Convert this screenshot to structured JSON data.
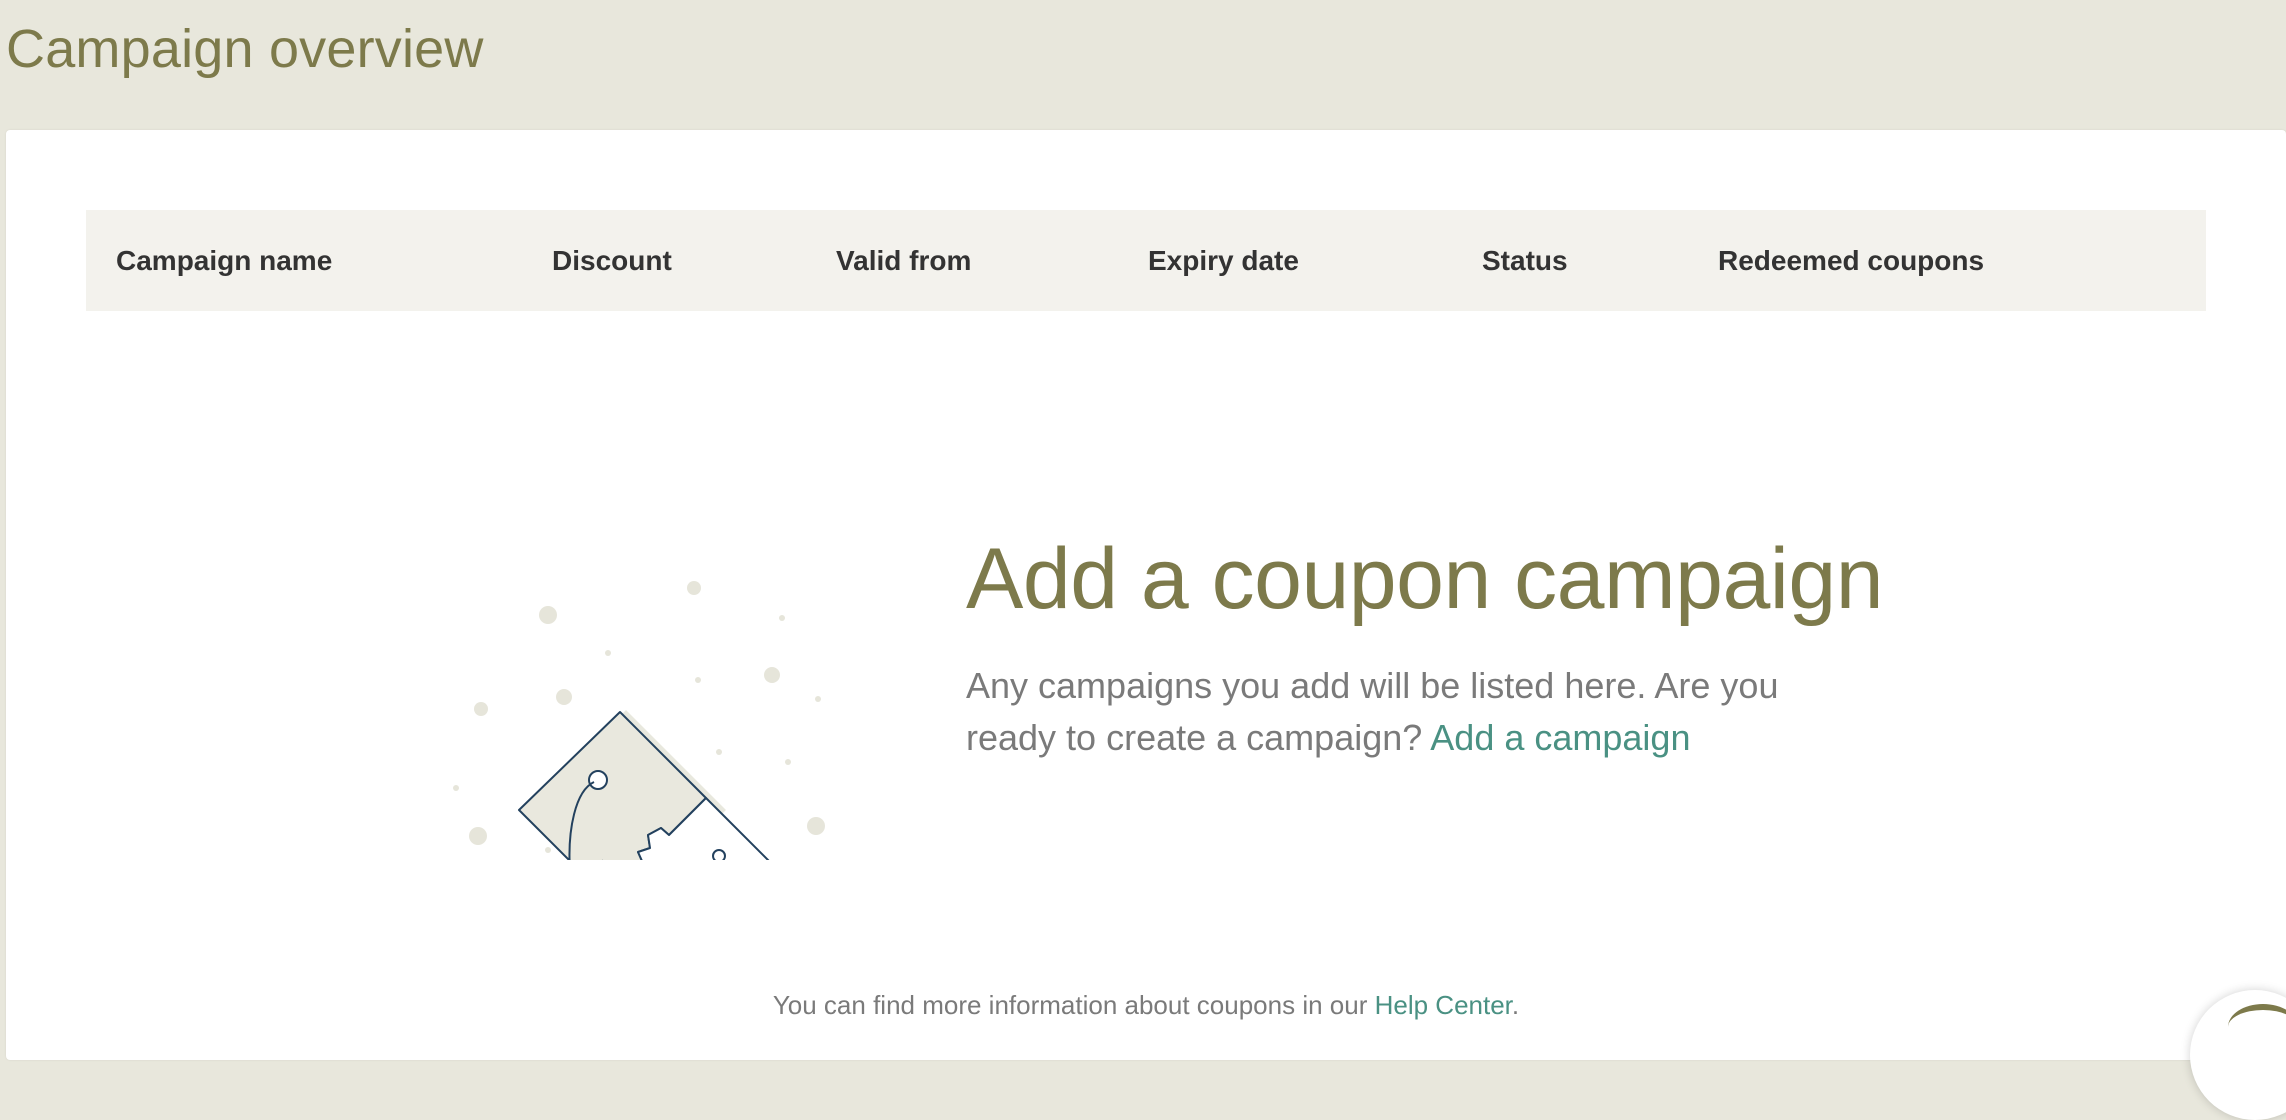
{
  "page": {
    "title": "Campaign overview"
  },
  "table": {
    "columns": [
      "Campaign name",
      "Discount",
      "Valid from",
      "Expiry date",
      "Status",
      "Redeemed coupons"
    ]
  },
  "empty_state": {
    "heading": "Add a coupon campaign",
    "body": "Any campaigns you add will be listed here. Are you ready to create a campaign?",
    "link_label": "Add a campaign",
    "illustration_icon": "coupon-tag-icon"
  },
  "footer": {
    "text": "You can find more information about coupons in our",
    "link_label": "Help Center",
    "suffix": "."
  },
  "colors": {
    "background": "#e8e7dc",
    "title": "#7d7a4b",
    "link": "#4a9183",
    "header_row": "#f3f2ed",
    "illustration_line": "#23415e"
  }
}
